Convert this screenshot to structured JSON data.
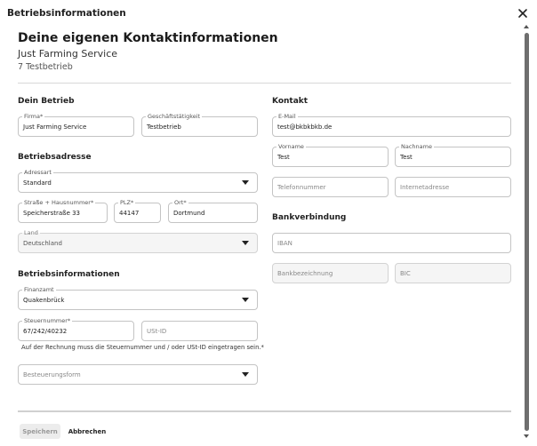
{
  "dialog": {
    "title": "Betriebsinformationen"
  },
  "header": {
    "heading": "Deine eigenen Kontaktinformationen",
    "company": "Just Farming Service",
    "subtitle": "7 Testbetrieb"
  },
  "betrieb": {
    "title": "Dein Betrieb",
    "firma": {
      "label": "Firma*",
      "value": "Just Farming Service"
    },
    "taetigkeit": {
      "label": "Geschäftstätigkeit",
      "value": "Testbetrieb"
    }
  },
  "adresse": {
    "title": "Betriebsadresse",
    "adressart": {
      "label": "Adressart",
      "value": "Standard"
    },
    "strasse": {
      "label": "Straße + Hausnummer*",
      "value": "Speicherstraße 33"
    },
    "plz": {
      "label": "PLZ*",
      "value": "44147"
    },
    "ort": {
      "label": "Ort*",
      "value": "Dortmund"
    },
    "land": {
      "label": "Land",
      "value": "Deutschland"
    }
  },
  "info": {
    "title": "Betriebsinformationen",
    "finanzamt": {
      "label": "Finanzamt",
      "value": "Quakenbrück"
    },
    "steuernummer": {
      "label": "Steuernummer*",
      "value": "67/242/40232"
    },
    "ustid": {
      "placeholder": "USt-ID"
    },
    "hint": "Auf der Rechnung muss die Steuernummer und / oder USt-ID eingetragen sein.*",
    "besteuerung": {
      "placeholder": "Besteuerungsform"
    }
  },
  "kontakt": {
    "title": "Kontakt",
    "email": {
      "label": "E-Mail",
      "value": "test@bkbkbkb.de"
    },
    "vorname": {
      "label": "Vorname",
      "value": "Test"
    },
    "nachname": {
      "label": "Nachname",
      "value": "Test"
    },
    "telefon": {
      "placeholder": "Telefonnummer"
    },
    "internet": {
      "placeholder": "Internetadresse"
    }
  },
  "bank": {
    "title": "Bankverbindung",
    "iban": {
      "placeholder": "IBAN"
    },
    "bankname": {
      "placeholder": "Bankbezeichnung"
    },
    "bic": {
      "placeholder": "BIC"
    }
  },
  "footer": {
    "save": "Speichern",
    "cancel": "Abbrechen"
  },
  "icons": {
    "close": "close-icon",
    "dropdown": "chevron-down-icon"
  }
}
